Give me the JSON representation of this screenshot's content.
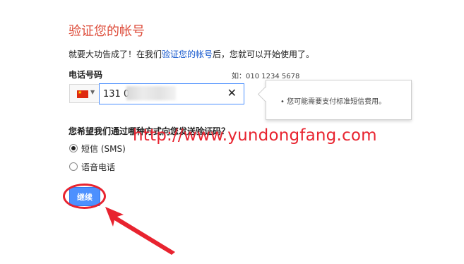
{
  "page": {
    "title": "验证您的帐号",
    "intro": {
      "before": "就要大功告成了！在我们",
      "link": "验证您的帐号",
      "after": "后，您就可以开始使用了。"
    }
  },
  "phone": {
    "label": "电话号码",
    "example_hint": "如：010 1234 5678",
    "value": "131 0",
    "country_flag": "china-flag-icon",
    "tooltip": "• 您可能需要支付标准短信费用。"
  },
  "method": {
    "question": "您希望我们通过哪种方式向您发送验证码？",
    "options": [
      {
        "label": "短信 (SMS)",
        "selected": true
      },
      {
        "label": "语音电话",
        "selected": false
      }
    ]
  },
  "continue_button": {
    "label": "继续"
  },
  "watermark": "http://www.yundongfang.com",
  "colors": {
    "title": "#dd4b39",
    "link": "#1155cc",
    "button": "#4d90fe",
    "annotation": "#e8232f"
  }
}
